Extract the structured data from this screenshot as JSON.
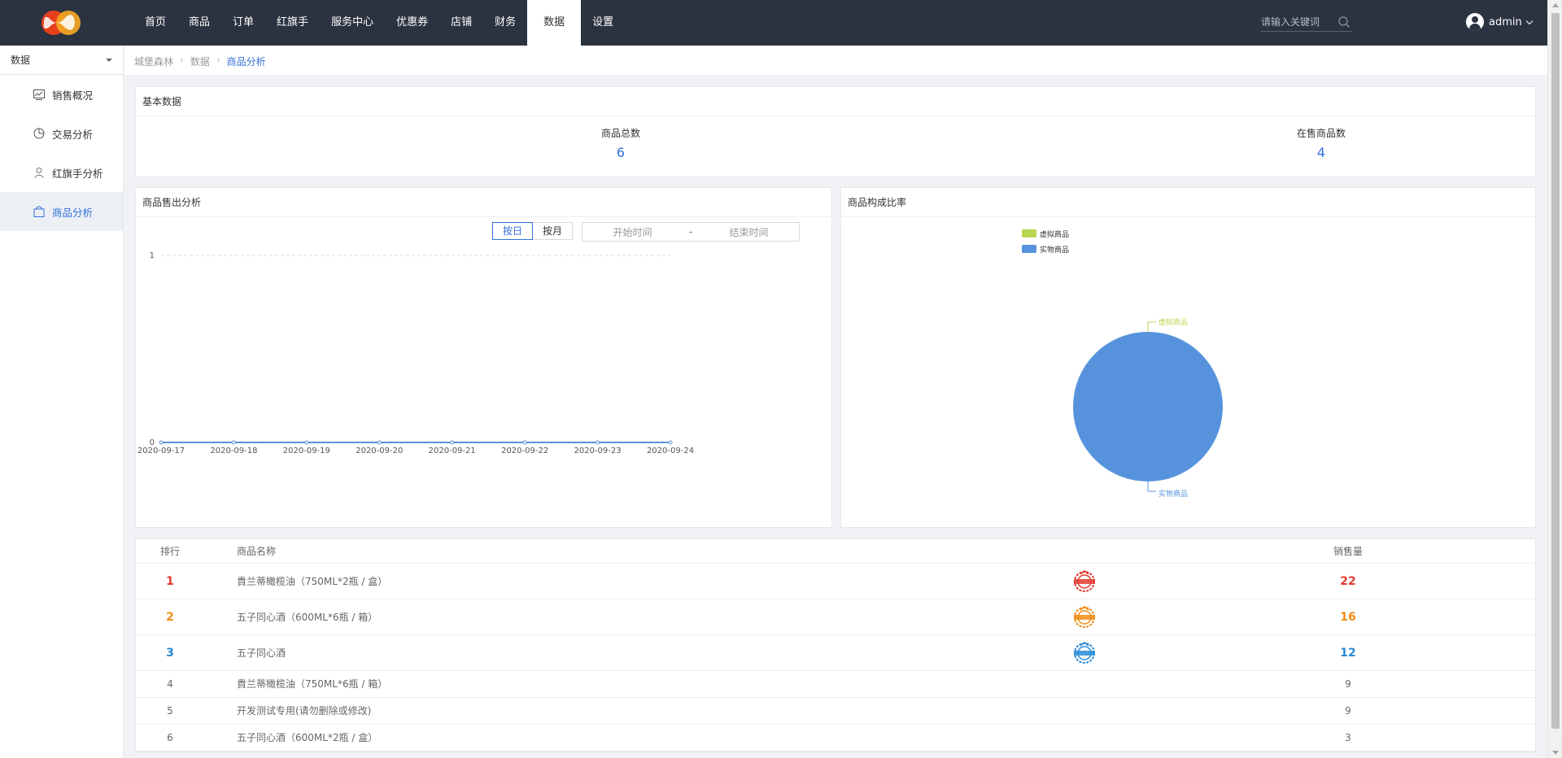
{
  "topbar": {
    "nav": [
      "首页",
      "商品",
      "订单",
      "红旗手",
      "服务中心",
      "优惠券",
      "店铺",
      "财务",
      "数据",
      "设置"
    ],
    "active_nav": "数据",
    "search_placeholder": "请输入关键词",
    "user_name": "admin"
  },
  "sidebar": {
    "select_label": "数据",
    "items": [
      {
        "label": "销售概况",
        "icon": "line-chart-icon"
      },
      {
        "label": "交易分析",
        "icon": "pie-chart-icon"
      },
      {
        "label": "红旗手分析",
        "icon": "user-icon"
      },
      {
        "label": "商品分析",
        "icon": "shopping-bag-icon",
        "active": true
      }
    ]
  },
  "breadcrumb": {
    "items": [
      "城堡森林",
      "数据",
      "商品分析"
    ],
    "separator": "›"
  },
  "basic_data": {
    "title": "基本数据",
    "stats": [
      {
        "label": "商品总数",
        "value": "6"
      },
      {
        "label": "在售商品数",
        "value": "4"
      }
    ]
  },
  "sales_analysis": {
    "title": "商品售出分析",
    "by_day": "按日",
    "by_month": "按月",
    "start_placeholder": "开始时间",
    "range_sep": "-",
    "end_placeholder": "结束时间"
  },
  "composition": {
    "title": "商品构成比率"
  },
  "ranking": {
    "headers": {
      "rank": "排行",
      "name": "商品名称",
      "sales": "销售量"
    },
    "rows": [
      {
        "rank": "1",
        "name": "貴兰蒂橄榄油（750ML*2瓶 / 盒）",
        "sales": "22",
        "color": "#e23a2e",
        "medal": "gold-medal-icon"
      },
      {
        "rank": "2",
        "name": "五子同心酒（600ML*6瓶 / 箱）",
        "sales": "16",
        "color": "#f08b13",
        "medal": "silver-medal-icon"
      },
      {
        "rank": "3",
        "name": "五子同心酒",
        "sales": "12",
        "color": "#2789d6",
        "medal": "bronze-medal-icon"
      },
      {
        "rank": "4",
        "name": "貴兰蒂橄榄油（750ML*6瓶 / 箱）",
        "sales": "9"
      },
      {
        "rank": "5",
        "name": "开发测试专用(请勿删除或修改)",
        "sales": "9"
      },
      {
        "rank": "6",
        "name": "五子同心酒（600ML*2瓶 / 盒）",
        "sales": "3"
      }
    ]
  },
  "chart_data": [
    {
      "type": "line",
      "x": [
        "2020-09-17",
        "2020-09-18",
        "2020-09-19",
        "2020-09-20",
        "2020-09-21",
        "2020-09-22",
        "2020-09-23",
        "2020-09-24"
      ],
      "series": [
        {
          "values": [
            0,
            0,
            0,
            0,
            0,
            0,
            0,
            0
          ]
        }
      ],
      "ylim": [
        0,
        1
      ],
      "yticks": [
        "0",
        "1"
      ],
      "grid": true,
      "color": "#5793dd"
    },
    {
      "type": "pie",
      "legend": [
        "虚拟商品",
        "实物商品"
      ],
      "legend_position": "top-left",
      "slices": [
        {
          "label": "虚拟商品",
          "value": 0,
          "color": "#b9d650"
        },
        {
          "label": "实物商品",
          "value": 6,
          "color": "#5793dd"
        }
      ]
    }
  ]
}
